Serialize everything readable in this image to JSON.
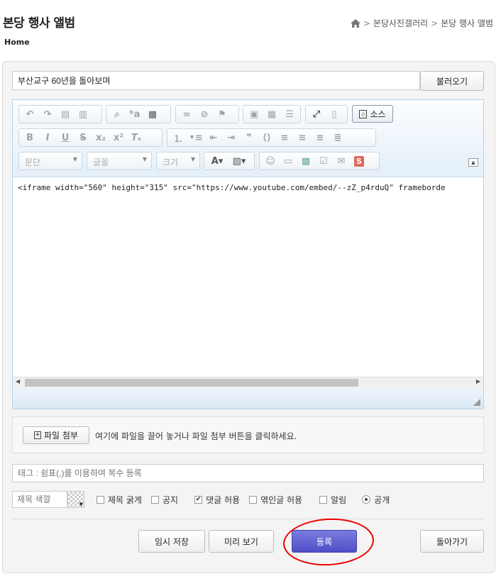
{
  "header": {
    "title": "본당 행사 앨범",
    "home_link": "Home"
  },
  "breadcrumb": {
    "items": [
      "본당사진갤러리",
      "본당 행사 앨범"
    ]
  },
  "form": {
    "title_value": "부산교구 60년을 돌아보며",
    "load_button": "불러오기",
    "editor": {
      "source_button": "소스",
      "paragraph_combo": "문단",
      "font_combo": "글꼴",
      "size_combo": "크기",
      "content": "<iframe width=\"560\" height=\"315\" src=\"https://www.youtube.com/embed/--zZ_p4rduQ\" frameborde"
    },
    "attach": {
      "button": "파일 첨부",
      "hint": "여기에 파일을 끌어 놓거나 파일 첨부 버튼을 클릭하세요."
    },
    "tag_placeholder": "태그 : 쉼표(,)를 이용하여 복수 등록",
    "title_color_label": "제목 색깔",
    "options": [
      {
        "label": "제목 굵게",
        "checked": false,
        "type": "checkbox"
      },
      {
        "label": "공지",
        "checked": false,
        "type": "checkbox"
      },
      {
        "label": "댓글 허용",
        "checked": true,
        "type": "checkbox"
      },
      {
        "label": "엮인글 허용",
        "checked": false,
        "type": "checkbox"
      },
      {
        "label": "알림",
        "checked": false,
        "type": "checkbox"
      },
      {
        "label": "공개",
        "checked": true,
        "type": "radio"
      }
    ],
    "buttons": {
      "temp_save": "임시 저장",
      "preview": "미리 보기",
      "submit": "등록",
      "back": "돌아가기"
    }
  }
}
